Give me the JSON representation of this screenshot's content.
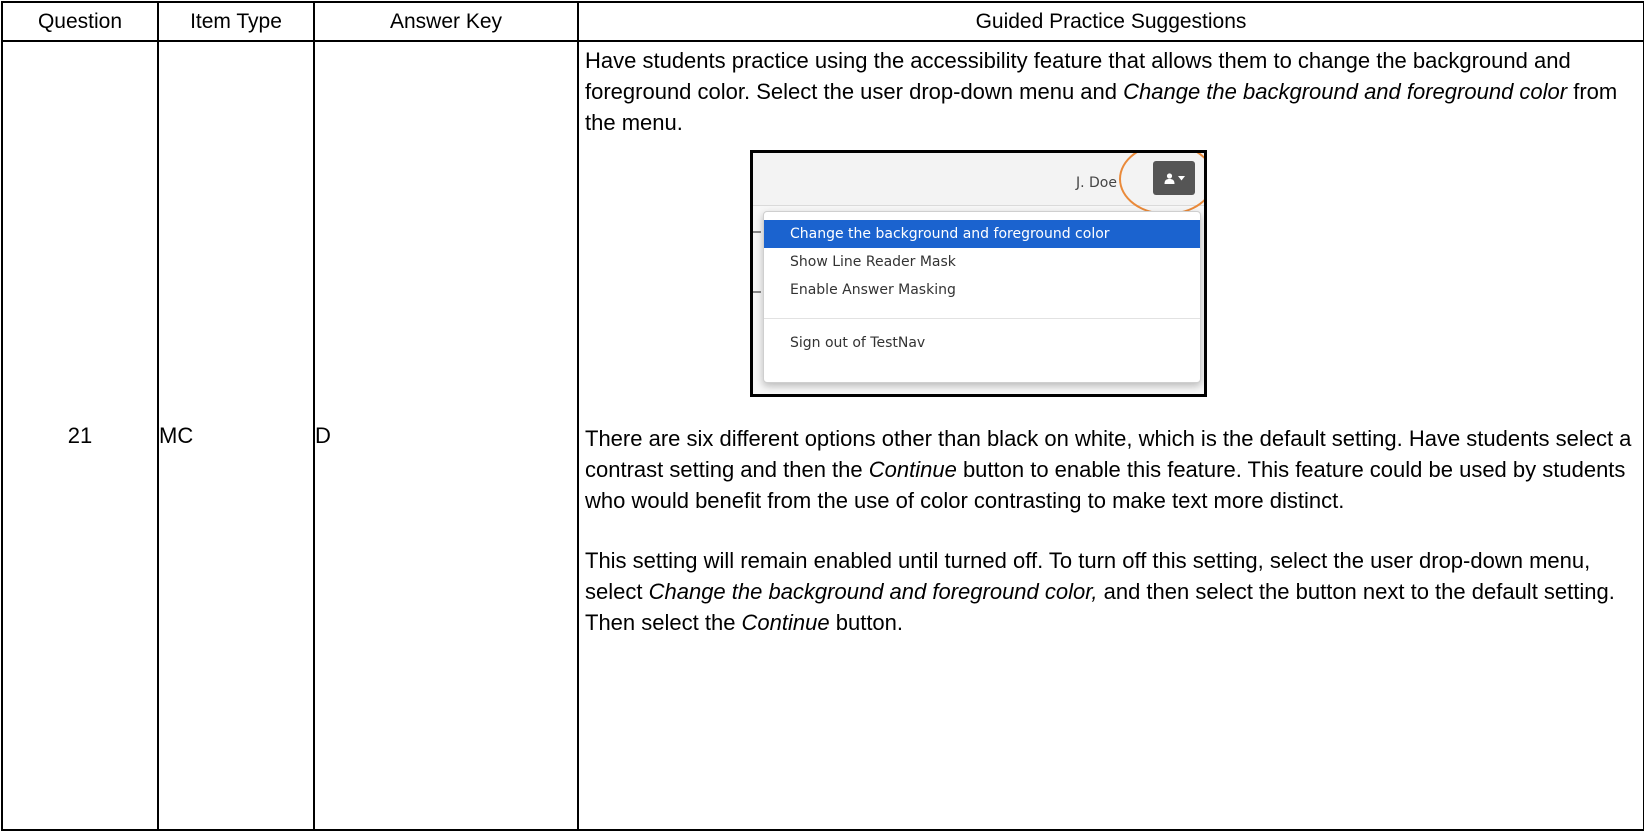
{
  "headers": {
    "question": "Question",
    "item_type": "Item Type",
    "answer_key": "Answer Key",
    "guided": "Guided Practice Suggestions"
  },
  "row": {
    "question": "21",
    "item_type": "MC",
    "answer_key": "D"
  },
  "guided": {
    "p1_a": "Have students practice using the accessibility feature that allows them to change the background and foreground color.  Select the user drop-down menu and ",
    "p1_em": "Change the background and foreground color",
    "p1_b": " from the menu.",
    "p2_a": "There are six different options other than black on white, which is the default setting.  Have students select a contrast setting and then the ",
    "p2_em": "Continue",
    "p2_b": " button to enable this feature. This feature could be used by students who would benefit from the use of color contrasting to make text more distinct.",
    "p3_a": "This setting will remain enabled until turned off.  To turn off this setting, select the user drop-down menu, select ",
    "p3_em": "Change the background and foreground color,",
    "p3_b": " and then select the button next to the default setting. Then select the ",
    "p3_em2": "Continue",
    "p3_c": " button."
  },
  "screenshot": {
    "user_name": "J. Doe",
    "menu": [
      "Change the background and foreground color",
      "Show Line Reader Mask",
      "Enable Answer Masking",
      "Sign out of TestNav"
    ],
    "user_icon": "user-icon",
    "caret_icon": "caret-down-icon",
    "highlight_color": "#1b63cf",
    "ring_color": "#ea8a3a"
  }
}
